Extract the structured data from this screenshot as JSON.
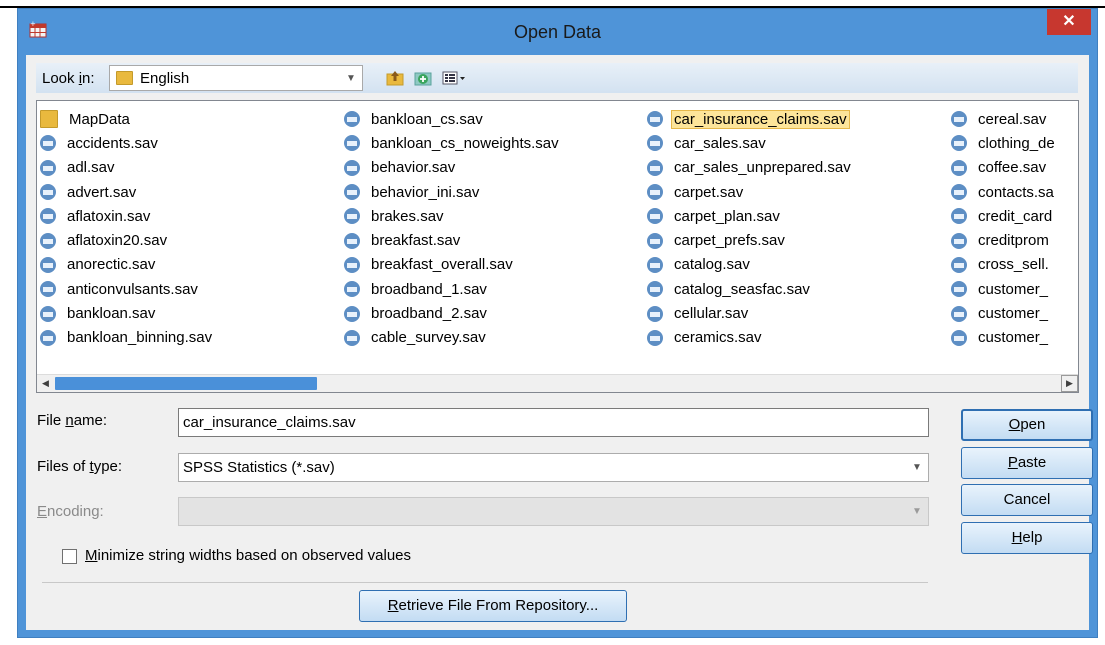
{
  "window": {
    "title": "Open Data",
    "close_glyph": "✕"
  },
  "look_in": {
    "label_pre": "Look ",
    "label_key": "i",
    "label_post": "n:",
    "value": "English"
  },
  "files": {
    "columns": [
      [
        {
          "name": "MapData",
          "type": "folder"
        },
        {
          "name": "accidents.sav",
          "type": "sav"
        },
        {
          "name": "adl.sav",
          "type": "sav"
        },
        {
          "name": "advert.sav",
          "type": "sav"
        },
        {
          "name": "aflatoxin.sav",
          "type": "sav"
        },
        {
          "name": "aflatoxin20.sav",
          "type": "sav"
        },
        {
          "name": "anorectic.sav",
          "type": "sav"
        },
        {
          "name": "anticonvulsants.sav",
          "type": "sav"
        },
        {
          "name": "bankloan.sav",
          "type": "sav"
        },
        {
          "name": "bankloan_binning.sav",
          "type": "sav"
        }
      ],
      [
        {
          "name": "bankloan_cs.sav",
          "type": "sav"
        },
        {
          "name": "bankloan_cs_noweights.sav",
          "type": "sav"
        },
        {
          "name": "behavior.sav",
          "type": "sav"
        },
        {
          "name": "behavior_ini.sav",
          "type": "sav"
        },
        {
          "name": "brakes.sav",
          "type": "sav"
        },
        {
          "name": "breakfast.sav",
          "type": "sav"
        },
        {
          "name": "breakfast_overall.sav",
          "type": "sav"
        },
        {
          "name": "broadband_1.sav",
          "type": "sav"
        },
        {
          "name": "broadband_2.sav",
          "type": "sav"
        },
        {
          "name": "cable_survey.sav",
          "type": "sav"
        }
      ],
      [
        {
          "name": "car_insurance_claims.sav",
          "type": "sav",
          "selected": true
        },
        {
          "name": "car_sales.sav",
          "type": "sav"
        },
        {
          "name": "car_sales_unprepared.sav",
          "type": "sav"
        },
        {
          "name": "carpet.sav",
          "type": "sav"
        },
        {
          "name": "carpet_plan.sav",
          "type": "sav"
        },
        {
          "name": "carpet_prefs.sav",
          "type": "sav"
        },
        {
          "name": "catalog.sav",
          "type": "sav"
        },
        {
          "name": "catalog_seasfac.sav",
          "type": "sav"
        },
        {
          "name": "cellular.sav",
          "type": "sav"
        },
        {
          "name": "ceramics.sav",
          "type": "sav"
        }
      ],
      [
        {
          "name": "cereal.sav",
          "type": "sav"
        },
        {
          "name": "clothing_de",
          "type": "sav"
        },
        {
          "name": "coffee.sav",
          "type": "sav"
        },
        {
          "name": "contacts.sa",
          "type": "sav"
        },
        {
          "name": "credit_card",
          "type": "sav"
        },
        {
          "name": "creditprom",
          "type": "sav"
        },
        {
          "name": "cross_sell.",
          "type": "sav"
        },
        {
          "name": "customer_",
          "type": "sav"
        },
        {
          "name": "customer_",
          "type": "sav"
        },
        {
          "name": "customer_",
          "type": "sav"
        }
      ]
    ]
  },
  "file_name": {
    "label_pre": "File ",
    "label_key": "n",
    "label_post": "ame:",
    "value": "car_insurance_claims.sav"
  },
  "files_of_type": {
    "label_pre": "Files of ",
    "label_key": "t",
    "label_post": "ype:",
    "value": "SPSS Statistics (*.sav)"
  },
  "encoding": {
    "label_pre": "",
    "label_key": "E",
    "label_post": "ncoding:",
    "value": ""
  },
  "minimize": {
    "label_key": "M",
    "label_post": "inimize string widths based on observed values",
    "checked": false
  },
  "retrieve": {
    "label_key": "R",
    "label_post": "etrieve File From Repository..."
  },
  "buttons": {
    "open": {
      "key": "O",
      "rest": "pen"
    },
    "paste": {
      "key": "P",
      "rest": "aste"
    },
    "cancel": {
      "key": "",
      "rest": "Cancel"
    },
    "help": {
      "key": "H",
      "rest": "elp"
    }
  },
  "colors": {
    "title_bar": "#4f94d8",
    "close": "#c7372f",
    "selection": "#fde59a",
    "scroll_thumb": "#4a90d9"
  }
}
